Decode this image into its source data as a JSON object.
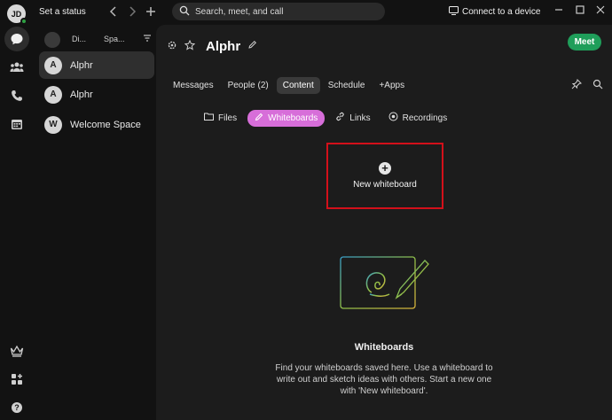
{
  "user": {
    "initials": "JD"
  },
  "topbar": {
    "status_label": "Set a status",
    "search_placeholder": "Search, meet, and call",
    "connect_label": "Connect to a device"
  },
  "spaces_panel": {
    "filters": [
      "Di...",
      "Spa..."
    ],
    "items": [
      {
        "initial": "A",
        "name": "Alphr"
      },
      {
        "initial": "A",
        "name": "Alphr"
      },
      {
        "initial": "W",
        "name": "Welcome Space"
      }
    ]
  },
  "space": {
    "title": "Alphr",
    "meet_label": "Meet",
    "tabs": [
      "Messages",
      "People (2)",
      "Content",
      "Schedule",
      "+Apps"
    ],
    "subtabs": [
      "Files",
      "Whiteboards",
      "Links",
      "Recordings"
    ]
  },
  "content": {
    "new_whiteboard_label": "New whiteboard",
    "empty_title": "Whiteboards",
    "empty_description": "Find your whiteboards saved here. Use a whiteboard to write out and sketch ideas with others. Start a new one with 'New whiteboard'."
  },
  "colors": {
    "accent_meet": "#1f9e5a",
    "active_subtab": "#d76ed9",
    "highlight_box": "#d3101a",
    "presence": "#2ea043"
  }
}
